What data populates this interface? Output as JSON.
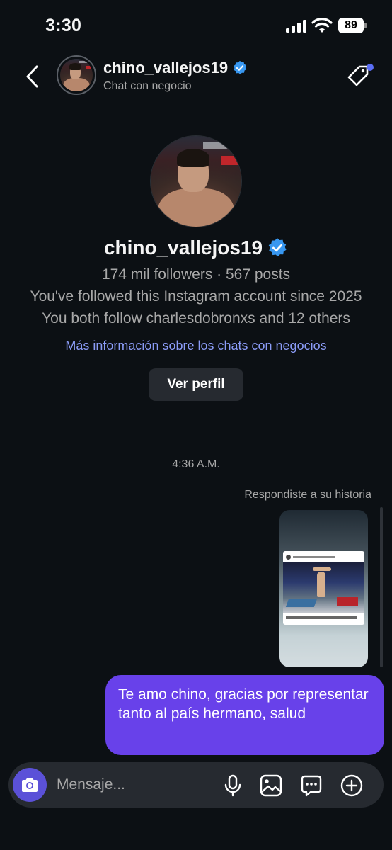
{
  "status_bar": {
    "time": "3:30",
    "battery": "89"
  },
  "header": {
    "username": "chino_vallejos19",
    "subtitle": "Chat con negocio"
  },
  "profile": {
    "username": "chino_vallejos19",
    "stats": "174 mil followers · 567 posts",
    "followed_since": "You've followed this Instagram account since 2025",
    "mutuals": "You both follow charlesdobronxs and 12 others",
    "info_link": "Más información sobre los chats con negocios",
    "view_profile_label": "Ver perfil"
  },
  "conversation": {
    "timestamp": "4:36 A.M.",
    "replied_label": "Respondiste a su historia",
    "message": "Te amo chino, gracias por representar tanto al país hermano, salud"
  },
  "composer": {
    "placeholder": "Mensaje..."
  },
  "colors": {
    "background": "#0c1014",
    "bubble": "#6841ea",
    "link": "#8b9cf7",
    "verified": "#3897f0",
    "camera_button": "#5b51d8"
  },
  "icons": [
    "back-chevron-icon",
    "verified-badge-icon",
    "tag-icon",
    "camera-icon",
    "microphone-icon",
    "gallery-icon",
    "sticker-icon",
    "plus-icon"
  ]
}
